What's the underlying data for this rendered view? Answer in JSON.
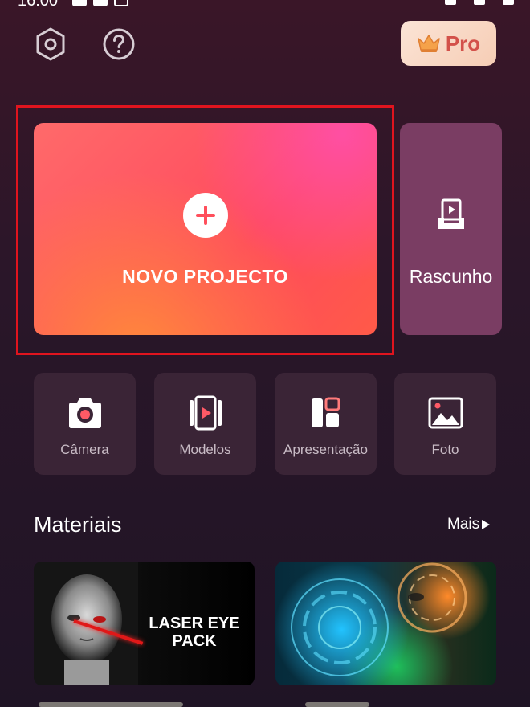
{
  "status_bar": {
    "time": "16:00"
  },
  "header": {
    "settings_icon": "hexagon-settings-icon",
    "help_icon": "help-circle-icon",
    "pro_label": "Pro",
    "pro_icon": "crown-icon"
  },
  "main": {
    "new_project_label": "NOVO PROJECTO",
    "draft_label": "Rascunho"
  },
  "quick_actions": [
    {
      "label": "Câmera",
      "icon": "camera-icon"
    },
    {
      "label": "Modelos",
      "icon": "video-template-icon"
    },
    {
      "label": "Apresentação",
      "icon": "layout-icon"
    },
    {
      "label": "Foto",
      "icon": "image-icon"
    }
  ],
  "materials": {
    "title": "Materiais",
    "more_label": "Mais",
    "items": [
      {
        "text": "LASER EYE PACK"
      },
      {
        "text": ""
      }
    ]
  },
  "colors": {
    "accent": "#ff4f5c",
    "pro_text": "#d3514a",
    "highlight": "#e0141e",
    "draft_bg": "#7a3d63",
    "tile_bg": "#3a2436"
  }
}
